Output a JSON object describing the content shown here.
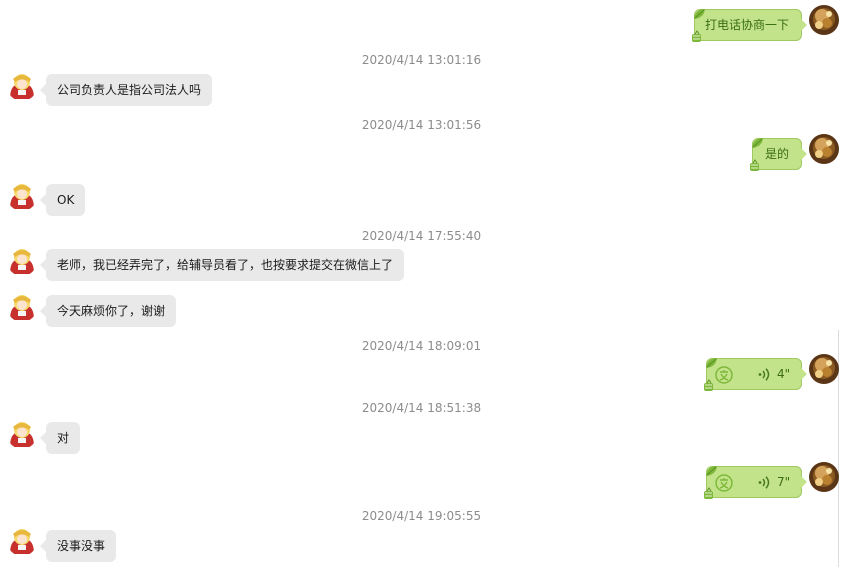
{
  "messages": [
    {
      "side": "out",
      "text": "打电话协商一下"
    },
    {
      "timestamp": "2020/4/14 13:01:16"
    },
    {
      "side": "in",
      "text": "公司负责人是指公司法人吗"
    },
    {
      "timestamp": "2020/4/14 13:01:56"
    },
    {
      "side": "out",
      "text": "是的"
    },
    {
      "side": "in",
      "text": "OK"
    },
    {
      "timestamp": "2020/4/14 17:55:40"
    },
    {
      "side": "in",
      "text": "老师，我已经弄完了，给辅导员看了，也按要求提交在微信上了"
    },
    {
      "side": "in",
      "text": "今天麻烦你了，谢谢"
    },
    {
      "timestamp": "2020/4/14 18:09:01"
    },
    {
      "side": "out",
      "type": "voice",
      "duration": "4\""
    },
    {
      "timestamp": "2020/4/14 18:51:38"
    },
    {
      "side": "in",
      "text": "对"
    },
    {
      "side": "out",
      "type": "voice",
      "duration": "7\""
    },
    {
      "timestamp": "2020/4/14 19:05:55"
    },
    {
      "side": "in",
      "text": "没事没事"
    }
  ],
  "colors": {
    "outgoing_bubble": "#c3e38a",
    "incoming_bubble": "#e9e9e9",
    "timestamp": "#8c8c8c"
  },
  "icons": {
    "voice_to_text": "voice-to-text-icon",
    "voice_wave": "voice-wave-icon",
    "bubble_leaf": "leaf-decoration-icon"
  }
}
